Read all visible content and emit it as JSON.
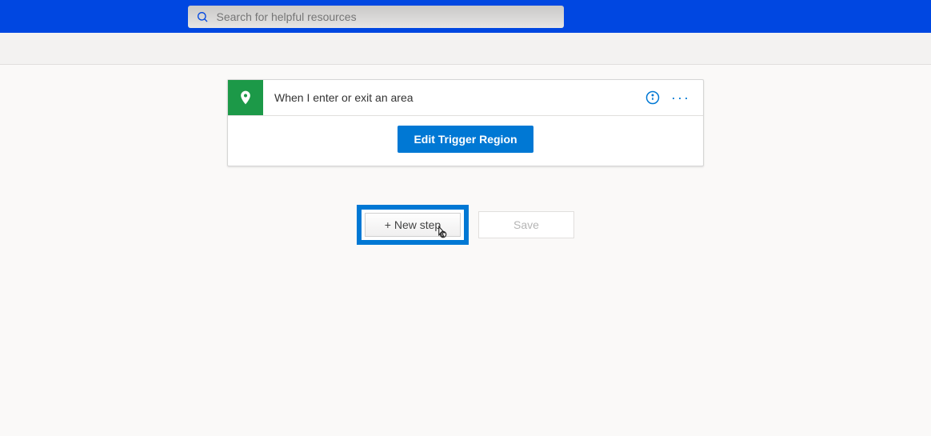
{
  "header": {
    "search_placeholder": "Search for helpful resources"
  },
  "trigger": {
    "title": "When I enter or exit an area",
    "icon": "location-pin-icon",
    "edit_button_label": "Edit Trigger Region"
  },
  "actions": {
    "new_step_label": "+ New step",
    "save_label": "Save"
  }
}
